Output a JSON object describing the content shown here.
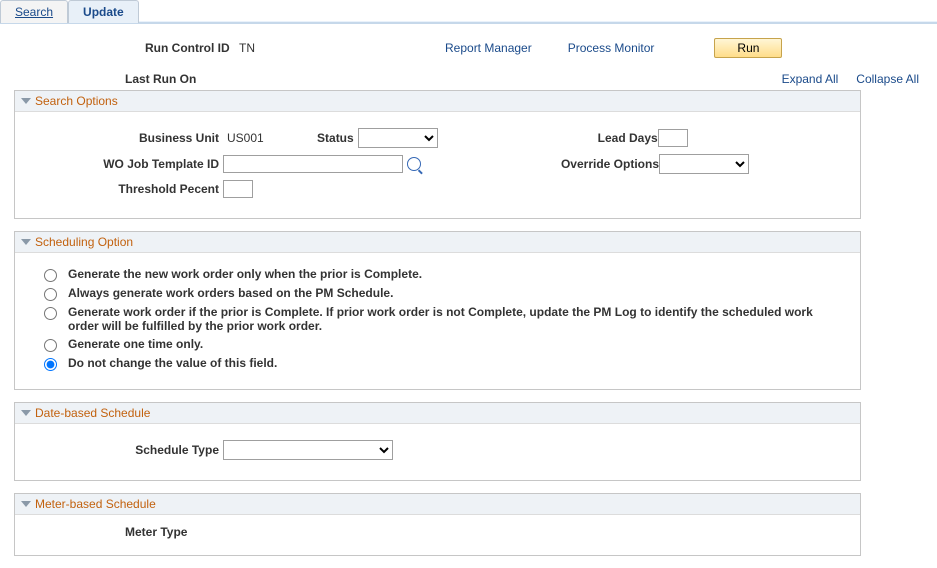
{
  "tabs": {
    "search": "Search",
    "update": "Update"
  },
  "top": {
    "runctl_label": "Run Control ID",
    "runctl_value": "TN",
    "report_manager": "Report Manager",
    "process_monitor": "Process Monitor",
    "run_btn": "Run"
  },
  "lastrun_label": "Last Run On",
  "expand_all": "Expand All",
  "collapse_all": "Collapse All",
  "search_options": {
    "title": "Search Options",
    "business_unit_label": "Business Unit",
    "business_unit_value": "US001",
    "status_label": "Status",
    "lead_days_label": "Lead Days",
    "wo_template_label": "WO Job Template ID",
    "override_label": "Override Options",
    "threshold_label": "Threshold Pecent"
  },
  "scheduling": {
    "title": "Scheduling Option",
    "opt1": "Generate the new work order only when the prior is Complete.",
    "opt2": "Always generate work orders based on the PM Schedule.",
    "opt3": "Generate work order if the prior is Complete. If prior work order is not Complete, update the PM Log to identify the scheduled work order will be fulfilled by the prior work order.",
    "opt4": "Generate one time only.",
    "opt5": "Do not change the value of this field."
  },
  "date_schedule": {
    "title": "Date-based Schedule",
    "schedule_type_label": "Schedule Type"
  },
  "meter_schedule": {
    "title": "Meter-based Schedule",
    "meter_type_label": "Meter Type"
  }
}
